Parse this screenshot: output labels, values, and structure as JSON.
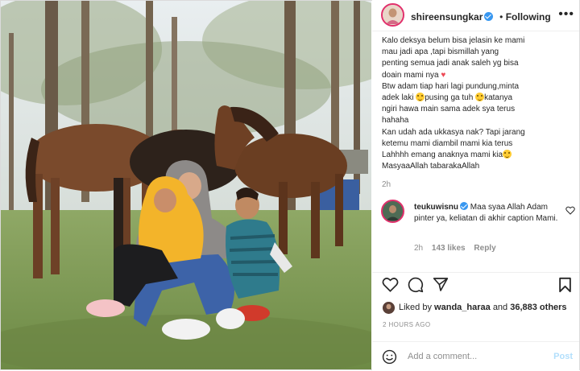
{
  "post": {
    "username": "shireensungkar",
    "follow_label": "Following",
    "more_icon": "more-horizontal-icon",
    "caption": {
      "l1": "Kalo deksya belum bisa jelasin ke mami",
      "l2": "mau jadi apa ,tapi bismillah yang",
      "l3": "penting semua jadi anak saleh yg bisa",
      "l4": "doain mami nya",
      "l5": "Btw adam tiap hari lagi pundung,minta",
      "l6a": "adek laki",
      "l6b": "pusing ga tuh",
      "l6c": "katanya",
      "l7": "ngiri hawa main sama adek sya terus",
      "l8": "hahaha",
      "l9": "Kan udah ada ukkasya nak? Tapi jarang",
      "l10": "ketemu mami diambil mami kia terus",
      "l11": "Lahhhh emang anaknya mami kia",
      "l12": "MasyaaAllah tabarakaAllah"
    },
    "caption_time": "2h"
  },
  "comment": {
    "username": "teukuwisnu",
    "text": "Maa syaa Allah Adam pinter ya, keliatan di akhir caption Mami.",
    "time": "2h",
    "likes": "143 likes",
    "reply_label": "Reply"
  },
  "actions": {
    "like_icon": "heart-icon",
    "comment_icon": "comment-icon",
    "share_icon": "share-icon",
    "save_icon": "bookmark-icon"
  },
  "likes": {
    "prefix": "Liked by",
    "user": "wanda_haraa",
    "and": "and",
    "count": "36,883 others"
  },
  "timestamp": "2 HOURS AGO",
  "add_comment": {
    "placeholder": "Add a comment...",
    "post_label": "Post"
  },
  "colors": {
    "verified": "#3897f0",
    "heart_red": "#ed4956",
    "post_disabled": "#b2dffc",
    "muted": "#8e8e8e"
  }
}
